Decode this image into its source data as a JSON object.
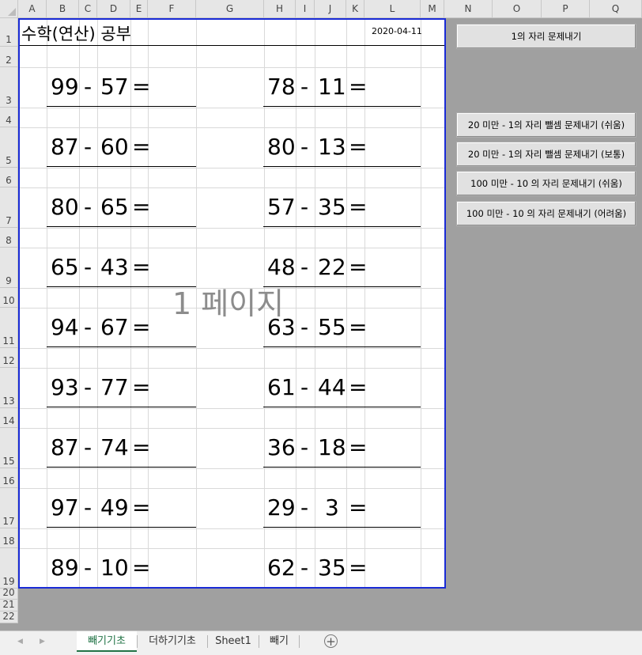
{
  "columns": [
    "A",
    "B",
    "C",
    "D",
    "E",
    "F",
    "G",
    "H",
    "I",
    "J",
    "K",
    "L",
    "M",
    "N",
    "O",
    "P",
    "Q"
  ],
  "rows": [
    "1",
    "2",
    "3",
    "4",
    "5",
    "6",
    "7",
    "8",
    "9",
    "10",
    "11",
    "12",
    "13",
    "14",
    "15",
    "16",
    "17",
    "18",
    "19",
    "20",
    "21",
    "22"
  ],
  "sheet": {
    "title": "수학(연산) 공부",
    "date": "2020-04-11",
    "watermark": "1 페이지"
  },
  "problems": [
    {
      "left": {
        "a": "99",
        "op": "-",
        "b": "57",
        "eq": "="
      },
      "right": {
        "a": "78",
        "op": "-",
        "b": "11",
        "eq": "="
      }
    },
    {
      "left": {
        "a": "87",
        "op": "-",
        "b": "60",
        "eq": "="
      },
      "right": {
        "a": "80",
        "op": "-",
        "b": "13",
        "eq": "="
      }
    },
    {
      "left": {
        "a": "80",
        "op": "-",
        "b": "65",
        "eq": "="
      },
      "right": {
        "a": "57",
        "op": "-",
        "b": "35",
        "eq": "="
      }
    },
    {
      "left": {
        "a": "65",
        "op": "-",
        "b": "43",
        "eq": "="
      },
      "right": {
        "a": "48",
        "op": "-",
        "b": "22",
        "eq": "="
      }
    },
    {
      "left": {
        "a": "94",
        "op": "-",
        "b": "67",
        "eq": "="
      },
      "right": {
        "a": "63",
        "op": "-",
        "b": "55",
        "eq": "="
      }
    },
    {
      "left": {
        "a": "93",
        "op": "-",
        "b": "77",
        "eq": "="
      },
      "right": {
        "a": "61",
        "op": "-",
        "b": "44",
        "eq": "="
      }
    },
    {
      "left": {
        "a": "87",
        "op": "-",
        "b": "74",
        "eq": "="
      },
      "right": {
        "a": "36",
        "op": "-",
        "b": "18",
        "eq": "="
      }
    },
    {
      "left": {
        "a": "97",
        "op": "-",
        "b": "49",
        "eq": "="
      },
      "right": {
        "a": "29",
        "op": "-",
        "b": "3",
        "eq": "="
      }
    },
    {
      "left": {
        "a": "89",
        "op": "-",
        "b": "10",
        "eq": "="
      },
      "right": {
        "a": "62",
        "op": "-",
        "b": "35",
        "eq": "="
      }
    }
  ],
  "buttons": {
    "ones": "1의 자리 문제내기",
    "under20_easy": "20 미만 - 1의 자리 뺄셈 문제내기 (쉬움)",
    "under20_normal": "20 미만 - 1의 자리 뺄셈 문제내기 (보통)",
    "under100_easy": "100 미만 - 10 의 자리 문제내기 (쉬움)",
    "under100_hard": "100 미만 - 10 의 자리 문제내기 (어려움)"
  },
  "tabs": [
    "빼기기초",
    "더하기기초",
    "Sheet1",
    "빼기"
  ],
  "active_tab": "빼기기초",
  "colors": {
    "page_border": "#1a2bd6",
    "active_tab": "#217346",
    "background": "#a0a0a0"
  },
  "icons": {
    "scroll_left": "triangle-left-icon",
    "scroll_right": "triangle-right-icon",
    "add_sheet": "plus-circle-icon"
  }
}
